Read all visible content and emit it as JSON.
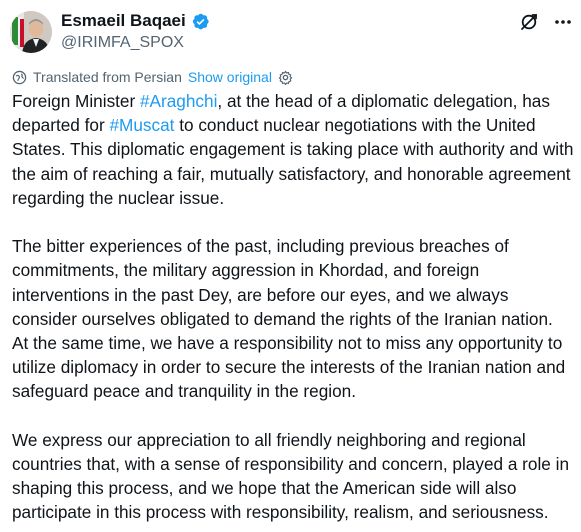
{
  "author": {
    "name": "Esmaeil Baqaei",
    "handle": "@IRIMFA_SPOX",
    "verified_color": "#1d9bf0"
  },
  "top_actions": {
    "grok_icon": "grok-icon",
    "more_icon": "more-options-icon"
  },
  "translation": {
    "note": "Translated from Persian",
    "show_original": "Show original",
    "icon": "globe-icon",
    "settings_icon": "gear-icon"
  },
  "post": {
    "p1_pre": "Foreign Minister ",
    "hashtag1": "#Araghchi",
    "p1_mid": ", at the head of a diplomatic delegation, has departed for ",
    "hashtag2": "#Muscat",
    "p1_post": " to conduct nuclear negotiations with the United States. This diplomatic engagement is taking place with authority and with the aim of reaching a fair, mutually satisfactory, and honorable agreement regarding the nuclear issue.",
    "p2": "The bitter experiences of the past, including previous breaches of commitments, the military aggression in Khordad, and foreign interventions in the past Dey, are before our eyes, and we always consider ourselves obligated to demand the rights of the Iranian nation.\nAt the same time, we have a responsibility not to miss any opportunity to utilize diplomacy in order to secure the interests of the Iranian nation and safeguard peace and tranquility in the region.",
    "p3": "We express our appreciation to all friendly neighboring and regional countries that, with a sense of responsibility and concern, played a role in shaping this process, and we hope that the American side will also participate in this process with responsibility, realism, and seriousness."
  },
  "colors": {
    "link": "#1d9bf0",
    "text": "#0f1419",
    "secondary": "#536471"
  }
}
